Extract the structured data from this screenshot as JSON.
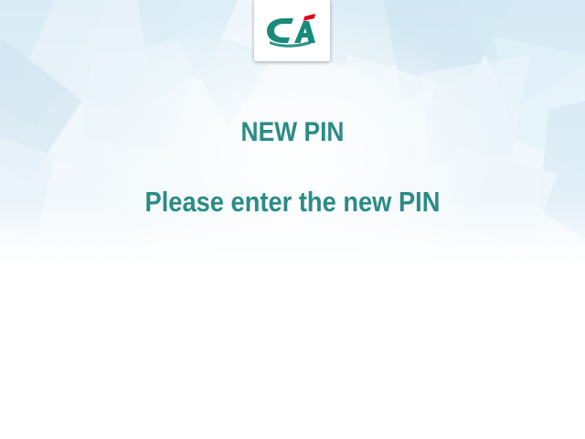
{
  "logo": {
    "icon": "credit-agricole-logo",
    "colors": {
      "green": "#1a8a7a",
      "red": "#e2001a"
    }
  },
  "screen": {
    "title": "NEW PIN",
    "instruction": "Please enter the new PIN"
  },
  "theme": {
    "text_color": "#2b8c85",
    "background": "#ffffff",
    "pattern_color": "#cfe6f2"
  }
}
